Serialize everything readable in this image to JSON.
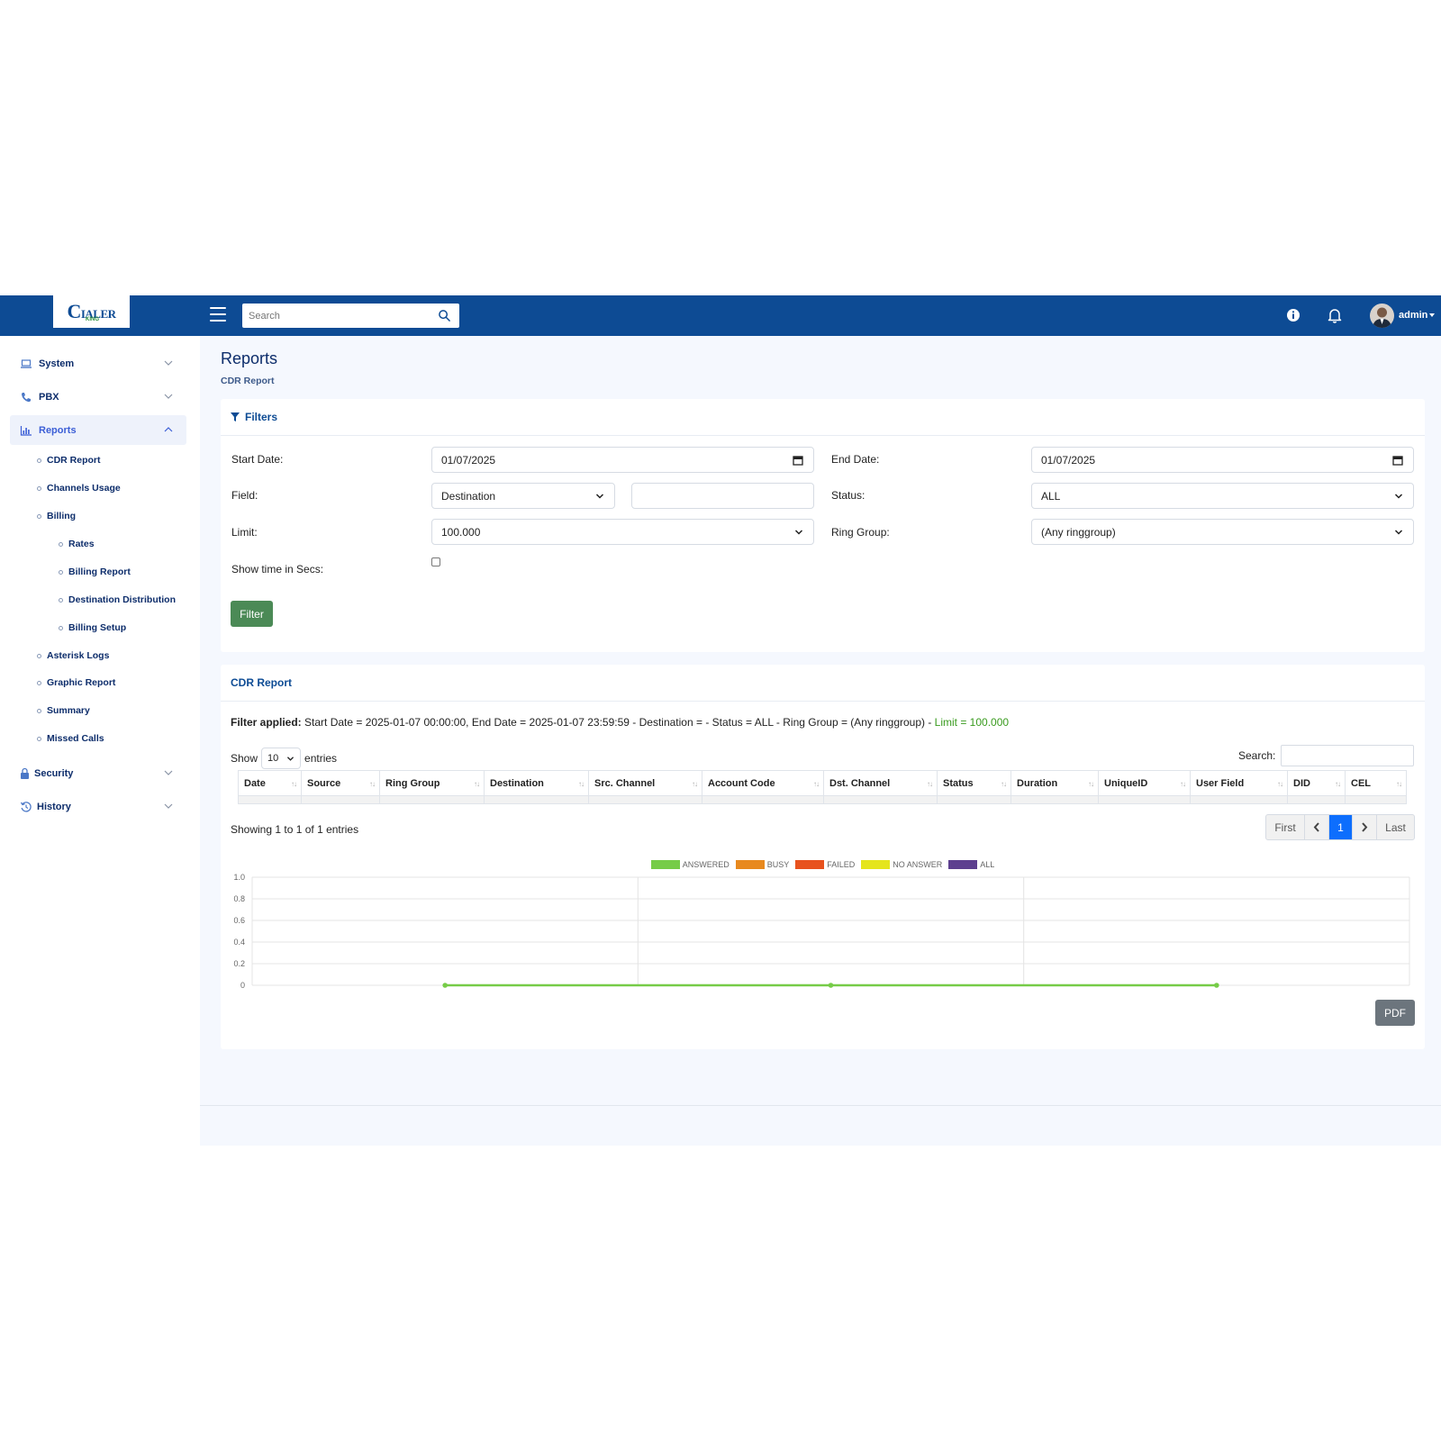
{
  "header": {
    "logo_text": "DIALER KING",
    "search_placeholder": "Search",
    "user_name": "admin"
  },
  "sidebar": {
    "items": [
      {
        "label": "System"
      },
      {
        "label": "PBX"
      },
      {
        "label": "Reports"
      },
      {
        "label": "Security"
      },
      {
        "label": "History"
      }
    ],
    "reports_sub": [
      {
        "label": "CDR Report"
      },
      {
        "label": "Channels Usage"
      },
      {
        "label": "Billing"
      },
      {
        "label": "Asterisk Logs"
      },
      {
        "label": "Graphic Report"
      },
      {
        "label": "Summary"
      },
      {
        "label": "Missed Calls"
      }
    ],
    "billing_sub": [
      {
        "label": "Rates"
      },
      {
        "label": "Billing Report"
      },
      {
        "label": "Destination Distribution"
      },
      {
        "label": "Billing Setup"
      }
    ]
  },
  "page": {
    "title": "Reports",
    "breadcrumb": "CDR Report"
  },
  "filters": {
    "heading": "Filters",
    "start_date_label": "Start Date:",
    "start_date": "01/07/2025",
    "end_date_label": "End Date:",
    "end_date": "01/07/2025",
    "field_label": "Field:",
    "field_value": "Destination",
    "field_text": "",
    "status_label": "Status:",
    "status_value": "ALL",
    "limit_label": "Limit:",
    "limit_value": "100.000",
    "ring_group_label": "Ring Group:",
    "ring_group_value": "(Any ringgroup)",
    "show_secs_label": "Show time in Secs:",
    "show_secs_checked": false,
    "button": "Filter"
  },
  "report": {
    "heading": "CDR Report",
    "filter_applied_label": "Filter applied:",
    "filter_applied_text": " Start Date = 2025-01-07 00:00:00, End Date = 2025-01-07 23:59:59 - Destination = - Status = ALL - Ring Group = (Any ringgroup) - ",
    "filter_applied_limit": "Limit = 100.000",
    "show_label": "Show",
    "entries_value": "10",
    "entries_label": "entries",
    "search_label": "Search:",
    "columns": [
      "Date",
      "Source",
      "Ring Group",
      "Destination",
      "Src. Channel",
      "Account Code",
      "Dst. Channel",
      "Status",
      "Duration",
      "UniqueID",
      "User Field",
      "DID",
      "CEL"
    ],
    "showing": "Showing 1 to 1 of 1 entries",
    "pager": {
      "first": "First",
      "current": "1",
      "last": "Last"
    },
    "pdf_button": "PDF"
  },
  "colors": {
    "header_bg": "#0d4b94",
    "answered": "#76cc48",
    "busy": "#e8891e",
    "failed": "#e8521e",
    "no_answer": "#e5e51c",
    "all": "#5d3f8f"
  },
  "chart_data": {
    "type": "line",
    "ylim": [
      0,
      1.0
    ],
    "yticks": [
      "1.0",
      "0.8",
      "0.6",
      "0.4",
      "0.2",
      "0"
    ],
    "legend": [
      {
        "name": "ANSWERED",
        "color": "#76cc48"
      },
      {
        "name": "BUSY",
        "color": "#e8891e"
      },
      {
        "name": "FAILED",
        "color": "#e8521e"
      },
      {
        "name": "NO ANSWER",
        "color": "#e5e51c"
      },
      {
        "name": "ALL",
        "color": "#5d3f8f"
      }
    ],
    "series": [
      {
        "name": "ANSWERED",
        "values": [
          0,
          0,
          0
        ],
        "color": "#76cc48"
      }
    ],
    "grid": true
  }
}
